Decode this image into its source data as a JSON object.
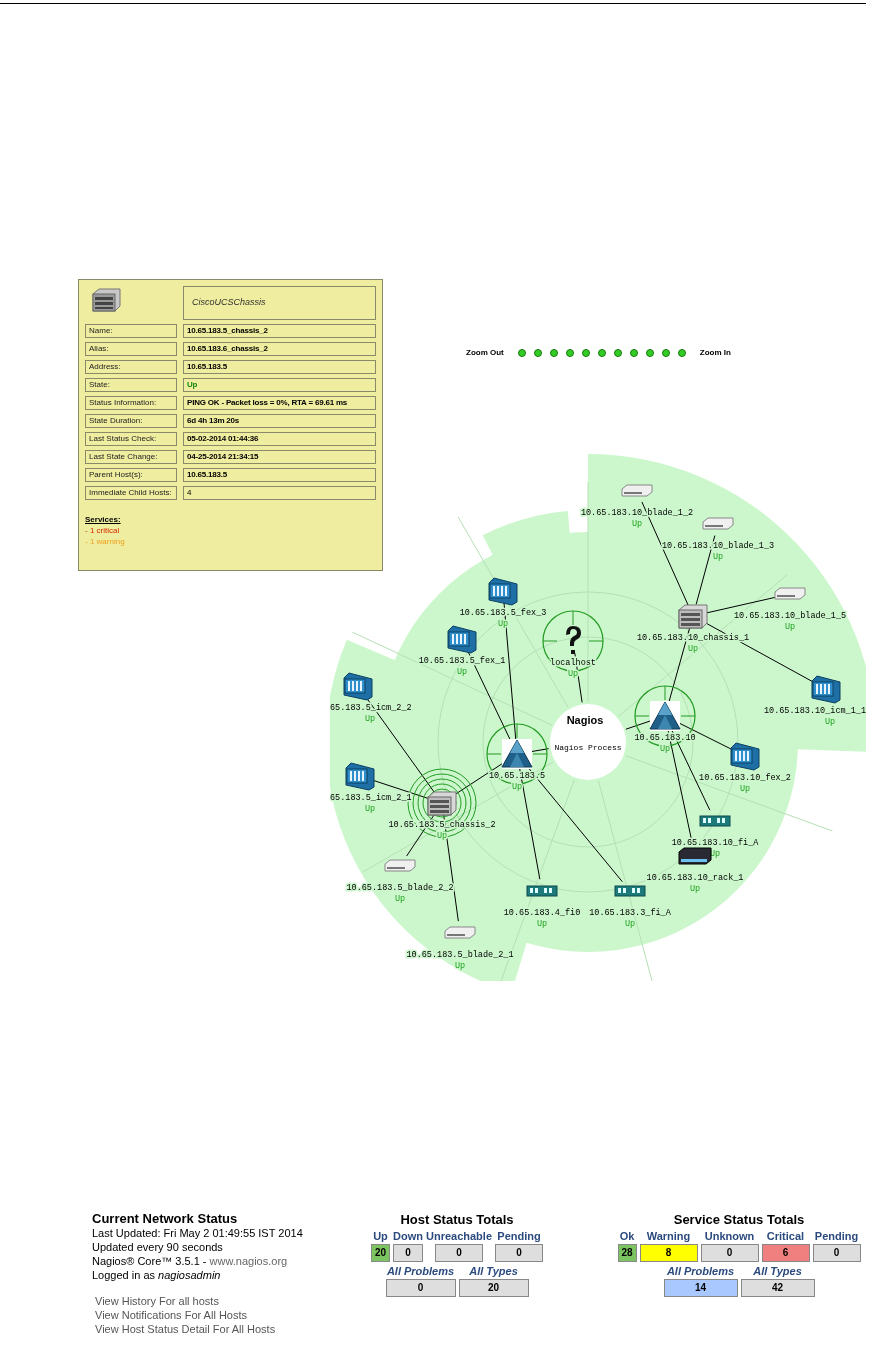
{
  "host_popup": {
    "title": "CiscoUCSChassis",
    "rows": [
      {
        "label": "Name:",
        "value": "10.65.183.5_chassis_2",
        "kind": "plain"
      },
      {
        "label": "Alias:",
        "value": "10.65.183.6_chassis_2",
        "kind": "plain"
      },
      {
        "label": "Address:",
        "value": "10.65.183.5",
        "kind": "plain"
      },
      {
        "label": "State:",
        "value": "Up",
        "kind": "up"
      },
      {
        "label": "Status Information:",
        "value": "PING OK - Packet loss = 0%, RTA = 69.61 ms",
        "kind": "plain"
      },
      {
        "label": "State Duration:",
        "value": "6d 4h 13m 20s",
        "kind": "plain"
      },
      {
        "label": "Last Status Check:",
        "value": "05-02-2014 01:44:36",
        "kind": "plain"
      },
      {
        "label": "Last State Change:",
        "value": "04-25-2014 21:34:15",
        "kind": "plain"
      },
      {
        "label": "Parent Host(s):",
        "value": "10.65.183.5",
        "kind": "plain"
      },
      {
        "label": "Immediate Child Hosts:",
        "value": "4",
        "kind": "count"
      }
    ],
    "services_heading": "Services:",
    "services": [
      {
        "text": "- 1 critical",
        "kind": "critical"
      },
      {
        "text": "- 1 warning",
        "kind": "warning"
      }
    ]
  },
  "zoom": {
    "out_label": "Zoom Out",
    "in_label": "Zoom In"
  },
  "status_map": {
    "root": {
      "label": "Nagios Process",
      "logo": "Nagios",
      "kind": "process",
      "children": [
        {
          "label": "localhost",
          "status": "Up",
          "kind": "unknown",
          "crosshair": true,
          "selected": false
        },
        {
          "label": "10.65.183.5",
          "status": "Up",
          "kind": "router",
          "crosshair": true,
          "selected": false,
          "children": [
            {
              "label": "10.65.183.5_fex_3",
              "status": "Up",
              "kind": "fex"
            },
            {
              "label": "10.65.183.5_fex_1",
              "status": "Up",
              "kind": "fex"
            },
            {
              "label": "10.65.183.5_chassis_2",
              "status": "Up",
              "kind": "chassis",
              "crosshair": false,
              "selected": true,
              "children": [
                {
                  "label": "65.183.5_icm_2_2",
                  "status": "Up",
                  "kind": "fex"
                },
                {
                  "label": "65.183.5_icm_2_1",
                  "status": "Up",
                  "kind": "fex"
                },
                {
                  "label": "10.65.183.5_blade_2_2",
                  "status": "Up",
                  "kind": "blade"
                },
                {
                  "label": "10.65.183.5_blade_2_1",
                  "status": "Up",
                  "kind": "blade"
                }
              ]
            },
            {
              "label": "10.65.183.4_fi0",
              "status": "Up",
              "kind": "fi"
            },
            {
              "label": "10.65.183.3_fi_A",
              "status": "Up",
              "kind": "fi"
            }
          ]
        },
        {
          "label": "10.65.183.10",
          "status": "Up",
          "kind": "router",
          "crosshair": true,
          "selected": false,
          "children": [
            {
              "label": "10.65.183.10_chassis_1",
              "status": "Up",
              "kind": "chassis",
              "children": [
                {
                  "label": "10.65.183.10_blade_1_2",
                  "status": "Up",
                  "kind": "blade"
                },
                {
                  "label": "10.65.183.10_blade_1_3",
                  "status": "Up",
                  "kind": "blade"
                },
                {
                  "label": "10.65.183.10_blade_1_5",
                  "status": "Up",
                  "kind": "blade"
                },
                {
                  "label": "10.65.183.10_icm_1_1",
                  "status": "Up",
                  "kind": "fex"
                }
              ]
            },
            {
              "label": "10.65.183.10_fex_2",
              "status": "Up",
              "kind": "fex"
            },
            {
              "label": "10.65.183.10_fi_A",
              "status": "Up",
              "kind": "fi"
            },
            {
              "label": "10.65.183.10_rack_1",
              "status": "Up",
              "kind": "rack"
            }
          ]
        }
      ]
    }
  },
  "network_status": {
    "title": "Current Network Status",
    "lines": [
      "Last Updated: Fri May 2 01:49:55 IST 2014",
      "Updated every 90 seconds"
    ],
    "version": "Nagios® Core™ 3.5.1 - ",
    "version_link": "www.nagios.org",
    "login_prefix": "Logged in as ",
    "login_user": "nagiosadmin",
    "links": [
      "View History For all hosts",
      "View Notifications For All Hosts",
      "View Host Status Detail For All Hosts"
    ]
  },
  "host_totals": {
    "title": "Host Status Totals",
    "cells": [
      {
        "label": "Up",
        "value": "20",
        "kind": "ok"
      },
      {
        "label": "Down",
        "value": "0",
        "kind": "none"
      },
      {
        "label": "Unreachable",
        "value": "0",
        "kind": "none"
      },
      {
        "label": "Pending",
        "value": "0",
        "kind": "none"
      }
    ],
    "summary": [
      {
        "label": "All Problems",
        "value": "0",
        "kind": "none"
      },
      {
        "label": "All Types",
        "value": "20",
        "kind": "none"
      }
    ]
  },
  "service_totals": {
    "title": "Service Status Totals",
    "cells": [
      {
        "label": "Ok",
        "value": "28",
        "kind": "ok"
      },
      {
        "label": "Warning",
        "value": "8",
        "kind": "warning"
      },
      {
        "label": "Unknown",
        "value": "0",
        "kind": "none"
      },
      {
        "label": "Critical",
        "value": "6",
        "kind": "critical"
      },
      {
        "label": "Pending",
        "value": "0",
        "kind": "none"
      }
    ],
    "summary": [
      {
        "label": "All Problems",
        "value": "14",
        "kind": "problems"
      },
      {
        "label": "All Types",
        "value": "42",
        "kind": "none"
      }
    ]
  }
}
